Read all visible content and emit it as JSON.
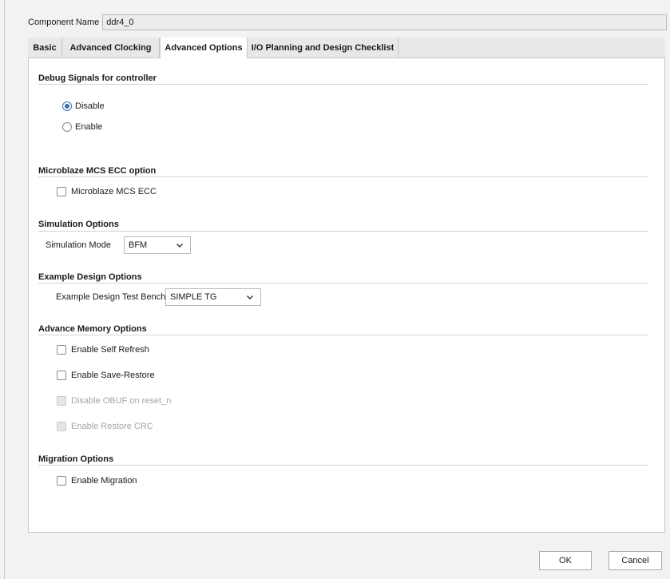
{
  "component": {
    "label": "Component Name",
    "value": "ddr4_0"
  },
  "tabs": [
    {
      "label": "Basic",
      "active": false
    },
    {
      "label": "Advanced Clocking",
      "active": false
    },
    {
      "label": "Advanced Options",
      "active": true
    },
    {
      "label": "I/O Planning and Design Checklist",
      "active": false
    }
  ],
  "debug": {
    "title": "Debug Signals for controller",
    "options": [
      {
        "label": "Disable",
        "selected": true
      },
      {
        "label": "Enable",
        "selected": false
      }
    ]
  },
  "mcs": {
    "title": "Microblaze MCS ECC option",
    "checkbox": {
      "label": "Microblaze MCS ECC",
      "checked": false
    }
  },
  "simulation": {
    "title": "Simulation Options",
    "label": "Simulation Mode",
    "value": "BFM"
  },
  "example": {
    "title": "Example Design Options",
    "label": "Example Design Test Bench",
    "value": "SIMPLE TG"
  },
  "advmem": {
    "title": "Advance Memory Options",
    "items": [
      {
        "label": "Enable Self Refresh",
        "checked": false,
        "enabled": true
      },
      {
        "label": "Enable Save-Restore",
        "checked": false,
        "enabled": true
      },
      {
        "label": "Disable OBUF on reset_n",
        "checked": false,
        "enabled": false
      },
      {
        "label": "Enable Restore CRC",
        "checked": false,
        "enabled": false
      }
    ]
  },
  "migration": {
    "title": "Migration Options",
    "checkbox": {
      "label": "Enable Migration",
      "checked": false
    }
  },
  "buttons": {
    "ok": "OK",
    "cancel": "Cancel"
  }
}
